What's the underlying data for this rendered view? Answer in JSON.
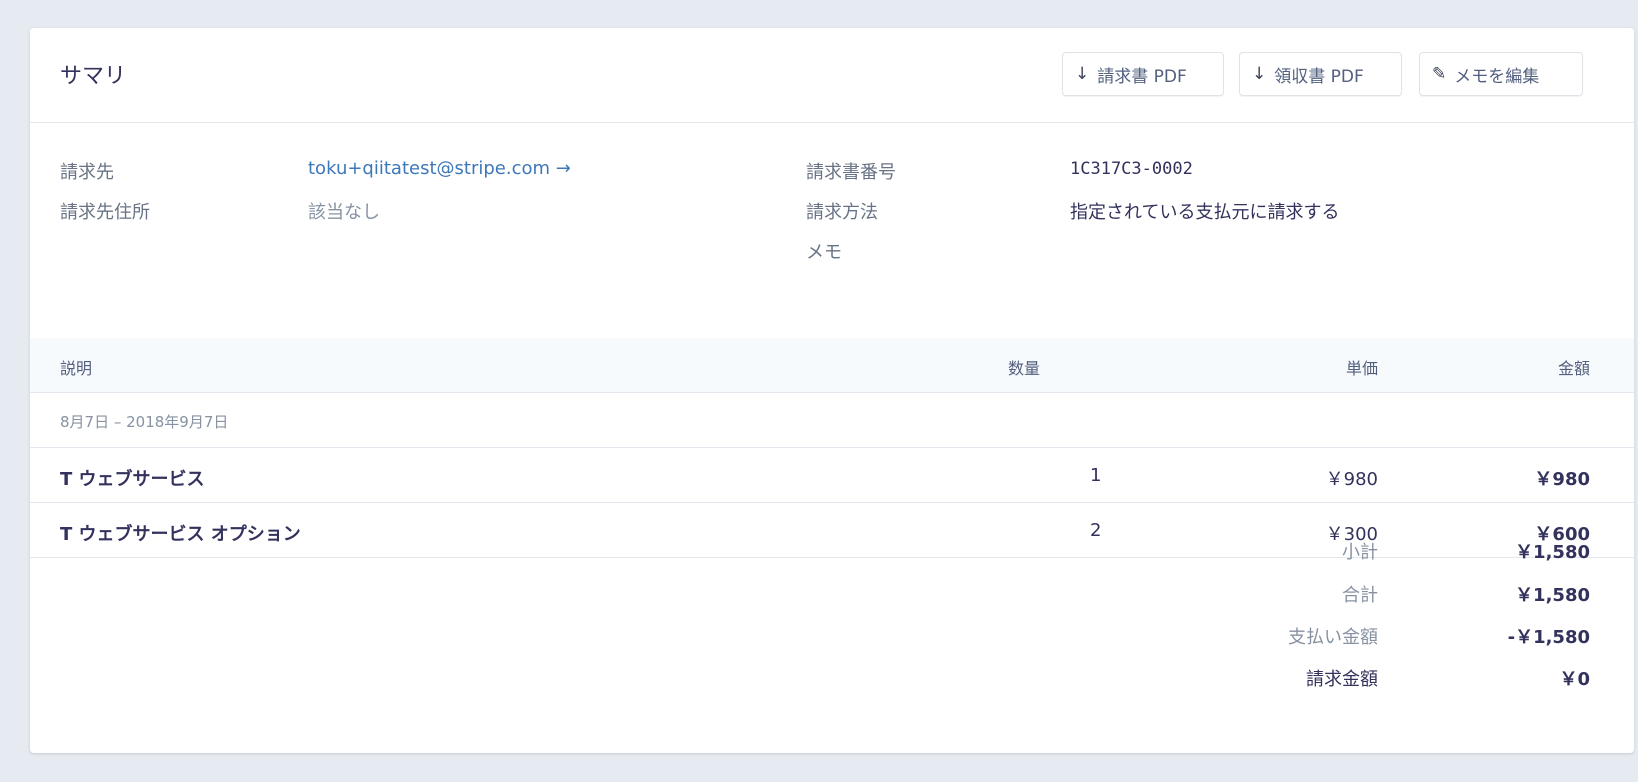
{
  "header": {
    "title": "サマリ",
    "buttons": {
      "invoice_pdf": "請求書 PDF",
      "receipt_pdf": "領収書 PDF",
      "edit_memo": "メモを編集"
    },
    "icons": {
      "download": "↓",
      "pencil": "✎"
    }
  },
  "info": {
    "bill_to_label": "請求先",
    "bill_to_value": "toku+qiitatest@stripe.com →",
    "address_label": "請求先住所",
    "address_value": "該当なし",
    "invoice_number_label": "請求書番号",
    "invoice_number_value": "1C317C3-0002",
    "billing_method_label": "請求方法",
    "billing_method_value": "指定されている支払元に請求する",
    "memo_label": "メモ"
  },
  "table": {
    "headers": {
      "description": "説明",
      "quantity": "数量",
      "unit_price": "単価",
      "amount": "金額"
    },
    "period": "8月7日 – 2018年9月7日",
    "rows": [
      {
        "description": "T ウェブサービス",
        "quantity": "1",
        "unit_price": "￥980",
        "amount": "￥980"
      },
      {
        "description": "T ウェブサービス オプション",
        "quantity": "2",
        "unit_price": "￥300",
        "amount": "￥600"
      }
    ]
  },
  "totals": [
    {
      "label": "小計",
      "value": "￥1,580"
    },
    {
      "label": "合計",
      "value": "￥1,580"
    },
    {
      "label": "支払い金額",
      "value": "-￥1,580"
    },
    {
      "label": "請求金額",
      "value": "￥0"
    }
  ],
  "colors": {
    "link": "#3d78b8",
    "text": "#32325d",
    "muted": "#8792a2",
    "background": "#e6ebf1"
  }
}
